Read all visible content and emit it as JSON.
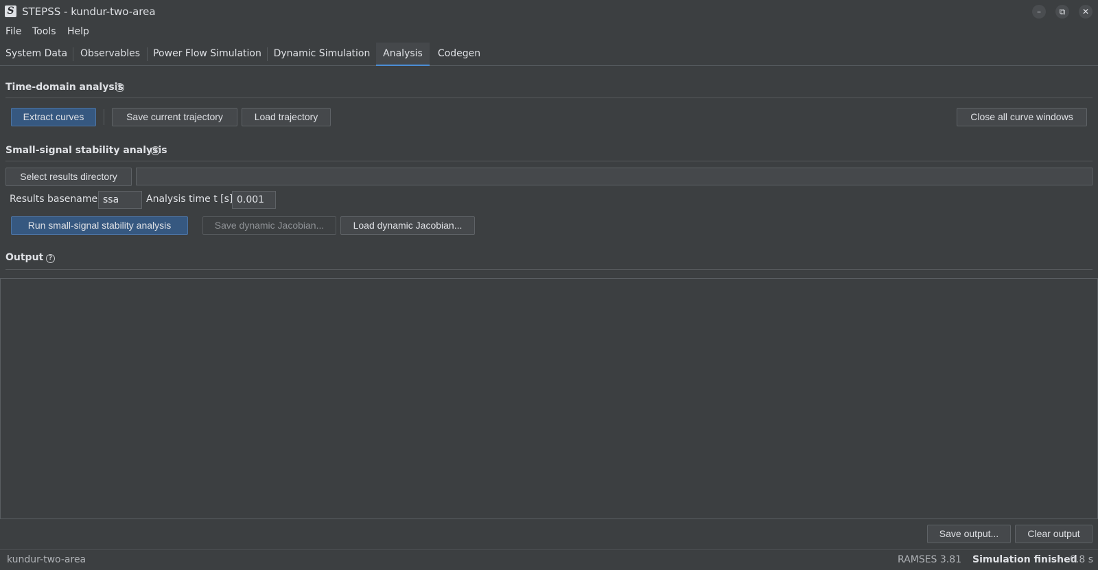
{
  "window": {
    "logo_letter": "S",
    "title": "STEPSS - kundur-two-area",
    "minimize_glyph": "–",
    "restore_glyph": "⧉",
    "close_glyph": "✕"
  },
  "menu": [
    "File",
    "Tools",
    "Help"
  ],
  "tabs": [
    {
      "label": "System Data",
      "active": false
    },
    {
      "label": "Observables",
      "active": false
    },
    {
      "label": "Power Flow Simulation",
      "active": false
    },
    {
      "label": "Dynamic Simulation",
      "active": false
    },
    {
      "label": "Analysis",
      "active": true
    },
    {
      "label": "Codegen",
      "active": false
    }
  ],
  "time_domain": {
    "title": "Time-domain analysis",
    "extract_label": "Extract curves",
    "save_traj_label": "Save current trajectory",
    "load_traj_label": "Load trajectory",
    "close_windows_label": "Close all curve windows"
  },
  "ssa": {
    "title": "Small-signal stability analysis",
    "select_dir_label": "Select results directory",
    "results_dir_value": "",
    "basename_label": "Results basename",
    "basename_value": "ssa",
    "time_label": "Analysis time t [s]",
    "time_value": "0.001",
    "run_label": "Run small-signal stability analysis",
    "save_jac_label": "Save dynamic Jacobian...",
    "load_jac_label": "Load dynamic Jacobian..."
  },
  "output": {
    "title": "Output",
    "content": "",
    "save_label": "Save output...",
    "clear_label": "Clear output"
  },
  "status": {
    "project": "kundur-two-area",
    "engine": "RAMSES 3.81",
    "state": "Simulation finished",
    "elapsed": "0.8 s"
  },
  "help_glyph": "?",
  "colors": {
    "background": "#3c3f41",
    "accent": "#4b8ed6",
    "primary_button": "#365880"
  }
}
